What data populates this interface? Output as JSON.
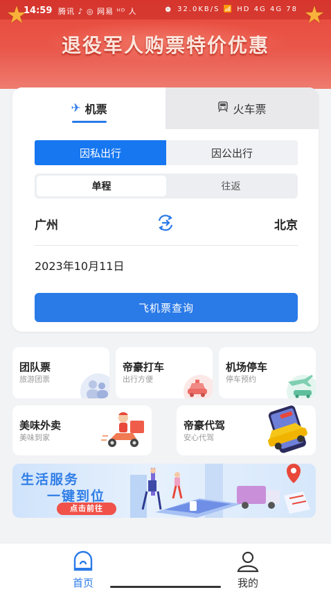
{
  "status_bar": {
    "time": "14:59",
    "apps_text": "腾讯 ♪ ◎ 网易 ᴴᴰ 人",
    "system_text": "⏰ 32.0KB/S 📶 HD 4G 4G 78"
  },
  "banner": {
    "title": "退役军人购票特价优惠"
  },
  "tabs": [
    {
      "label": "机票",
      "icon": "airplane-icon",
      "active": true
    },
    {
      "label": "火车票",
      "icon": "train-icon",
      "active": false
    }
  ],
  "purpose": {
    "options": [
      "因私出行",
      "因公出行"
    ],
    "selected": "因私出行"
  },
  "trip_type": {
    "options": [
      "单程",
      "往返"
    ],
    "selected": "单程"
  },
  "route": {
    "from": "广州",
    "to": "北京"
  },
  "date": "2023年10月11日",
  "search_button": "飞机票查询",
  "services": [
    {
      "title": "团队票",
      "subtitle": "旅游团票",
      "icon": "group-people-icon"
    },
    {
      "title": "帝豪打车",
      "subtitle": "出行方便",
      "icon": "taxi-car-icon"
    },
    {
      "title": "机场停车",
      "subtitle": "停车预约",
      "icon": "parking-plane-icon"
    },
    {
      "title": "美味外卖",
      "subtitle": "美味到家",
      "icon": "delivery-scooter-icon"
    },
    {
      "title": "帝豪代驾",
      "subtitle": "安心代驾",
      "icon": "phone-car-icon"
    }
  ],
  "life_banner": {
    "line1": "生活服务",
    "line2": "一键到位",
    "button": "点击前往"
  },
  "bottom_nav": [
    {
      "label": "首页",
      "icon": "home-icon",
      "active": true
    },
    {
      "label": "我的",
      "icon": "user-icon",
      "active": false
    }
  ],
  "colors": {
    "primary": "#2a7ae8",
    "banner_red": "#e8483a",
    "accent_red": "#f0524a"
  }
}
